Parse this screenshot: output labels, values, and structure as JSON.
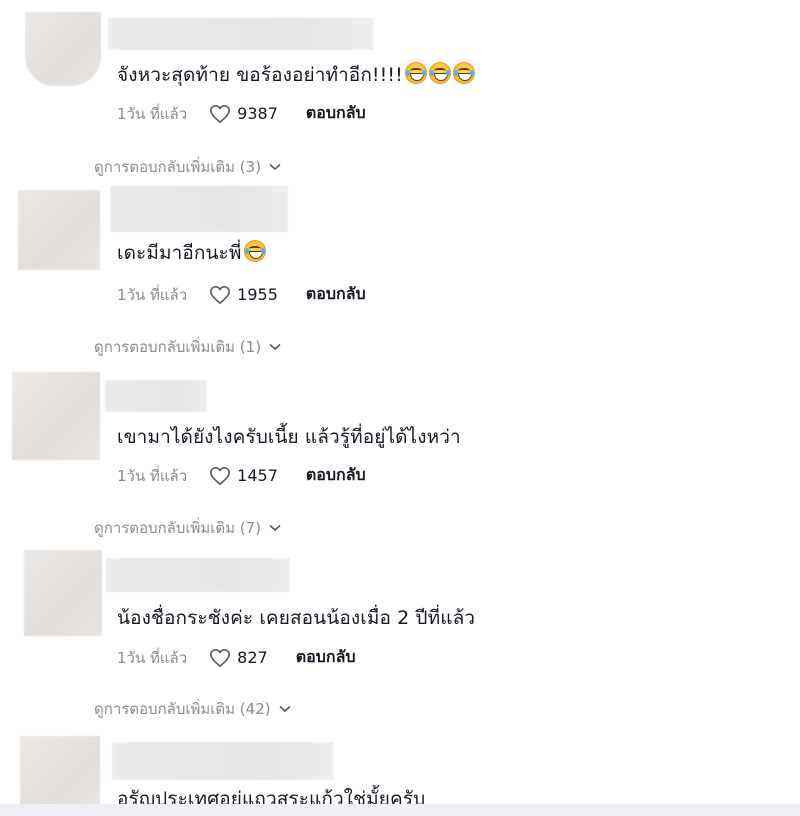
{
  "comments": [
    {
      "text": "จังหวะสุดท้าย ขอร้องอย่าทำอีก!!!!",
      "time": "1วัน ที่แล้ว",
      "likes": "9387",
      "reply": "ตอบกลับ",
      "more_replies": "ดูการตอบกลับเพิ่มเติม (3)"
    },
    {
      "text": "เดะมีมาอีกนะพี่",
      "time": "1วัน ที่แล้ว",
      "likes": "1955",
      "reply": "ตอบกลับ",
      "more_replies": "ดูการตอบกลับเพิ่มเติม (1)"
    },
    {
      "text": "เขามาได้ยังไงครับเนี้ย แล้วรู้ที่อยู่ได้ไงหว่า",
      "time": "1วัน ที่แล้ว",
      "likes": "1457",
      "reply": "ตอบกลับ",
      "more_replies": "ดูการตอบกลับเพิ่มเติม (7)"
    },
    {
      "text": "น้องชื่อกระชังค่ะ เคยสอนน้องเมื่อ 2 ปีที่แล้ว",
      "time": "1วัน ที่แล้ว",
      "likes": "827",
      "reply": "ตอบกลับ",
      "more_replies": "ดูการตอบกลับเพิ่มเติม (42)"
    },
    {
      "text": "อรัญประเทศอยู่แถวสระแก้วใช่มั้ยครับ"
    }
  ],
  "icons": {
    "like": "heart-outline-icon",
    "expand": "chevron-down-icon",
    "emoji": "face-with-tears-of-joy-emoji"
  },
  "colors": {
    "text": "#161823",
    "muted": "#8a8b91",
    "emoji": "#f7b733"
  }
}
